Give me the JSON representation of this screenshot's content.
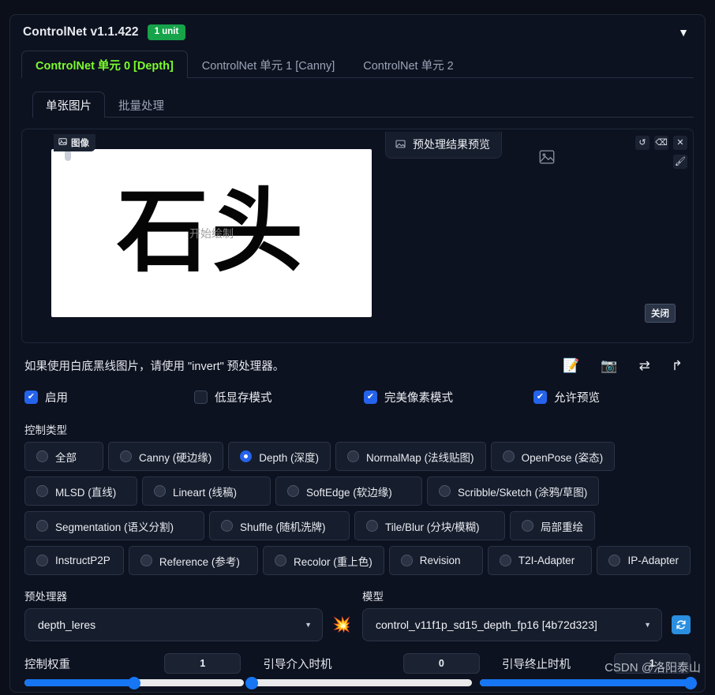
{
  "header": {
    "title": "ControlNet v1.1.422",
    "unit_badge": "1 unit",
    "collapse_icon": "▼"
  },
  "unit_tabs": [
    {
      "label": "ControlNet 单元 0 [Depth]",
      "active": true
    },
    {
      "label": "ControlNet 单元 1 [Canny]",
      "active": false
    },
    {
      "label": "ControlNet 单元 2",
      "active": false
    }
  ],
  "sub_tabs": [
    {
      "label": "单张图片",
      "active": true
    },
    {
      "label": "批量处理",
      "active": false
    }
  ],
  "image_pane": {
    "tag_label": "图像",
    "tag_icon": "image-icon",
    "content_text": "石头",
    "draw_overlay": "开始绘制",
    "tools": [
      {
        "name": "undo-icon",
        "glyph": "↺"
      },
      {
        "name": "erase-icon",
        "glyph": "⌫"
      },
      {
        "name": "clear-icon",
        "glyph": "✕"
      }
    ],
    "tool_secondary": {
      "name": "brush-icon",
      "glyph": "🖌"
    }
  },
  "preview": {
    "title": "预处理结果预览",
    "title_icon": "image-icon",
    "empty_icon": "image-placeholder-icon",
    "close_label": "关闭"
  },
  "hint": {
    "text": "如果使用白底黑线图片，请使用 \"invert\" 预处理器。",
    "icons": [
      {
        "name": "edit-note-icon",
        "glyph": "📝"
      },
      {
        "name": "camera-icon",
        "glyph": "📷"
      },
      {
        "name": "swap-icon",
        "glyph": "⇄"
      },
      {
        "name": "send-up-icon",
        "glyph": "↱"
      }
    ]
  },
  "checkboxes": [
    {
      "label": "启用",
      "checked": true
    },
    {
      "label": "低显存模式",
      "checked": false
    },
    {
      "label": "完美像素模式",
      "checked": true
    },
    {
      "label": "允许预览",
      "checked": true
    }
  ],
  "control_type": {
    "label": "控制类型",
    "rows": [
      [
        {
          "label": "全部",
          "selected": false
        },
        {
          "label": "Canny (硬边缘)",
          "selected": false
        },
        {
          "label": "Depth (深度)",
          "selected": true
        },
        {
          "label": "NormalMap (法线贴图)",
          "selected": false
        },
        {
          "label": "OpenPose (姿态)",
          "selected": false
        }
      ],
      [
        {
          "label": "MLSD (直线)",
          "selected": false
        },
        {
          "label": "Lineart (线稿)",
          "selected": false
        },
        {
          "label": "SoftEdge (软边缘)",
          "selected": false
        },
        {
          "label": "Scribble/Sketch (涂鸦/草图)",
          "selected": false
        }
      ],
      [
        {
          "label": "Segmentation (语义分割)",
          "selected": false
        },
        {
          "label": "Shuffle (随机洗牌)",
          "selected": false
        },
        {
          "label": "Tile/Blur (分块/模糊)",
          "selected": false
        },
        {
          "label": "局部重绘",
          "selected": false
        }
      ],
      [
        {
          "label": "InstructP2P",
          "selected": false
        },
        {
          "label": "Reference (参考)",
          "selected": false
        },
        {
          "label": "Recolor (重上色)",
          "selected": false
        },
        {
          "label": "Revision",
          "selected": false
        },
        {
          "label": "T2I-Adapter",
          "selected": false
        },
        {
          "label": "IP-Adapter",
          "selected": false
        }
      ]
    ]
  },
  "preprocessor": {
    "label": "预处理器",
    "value": "depth_leres",
    "caret": "▼",
    "run_icon": "💥"
  },
  "model": {
    "label": "模型",
    "value": "control_v11f1p_sd15_depth_fp16 [4b72d323]",
    "caret": "▼",
    "refresh_icon": "🔄"
  },
  "sliders": [
    {
      "label": "控制权重",
      "value": "1",
      "percent": 50
    },
    {
      "label": "引导介入时机",
      "value": "0",
      "percent": 0
    },
    {
      "label": "引导终止时机",
      "value": "1",
      "percent": 100
    }
  ],
  "watermark": "CSDN @洛阳泰山",
  "colors": {
    "accent_green": "#7cfc2e",
    "badge_green": "#16a34a",
    "accent_blue": "#2563eb",
    "slider_blue": "#1676f3",
    "bg": "#0b0f19"
  }
}
